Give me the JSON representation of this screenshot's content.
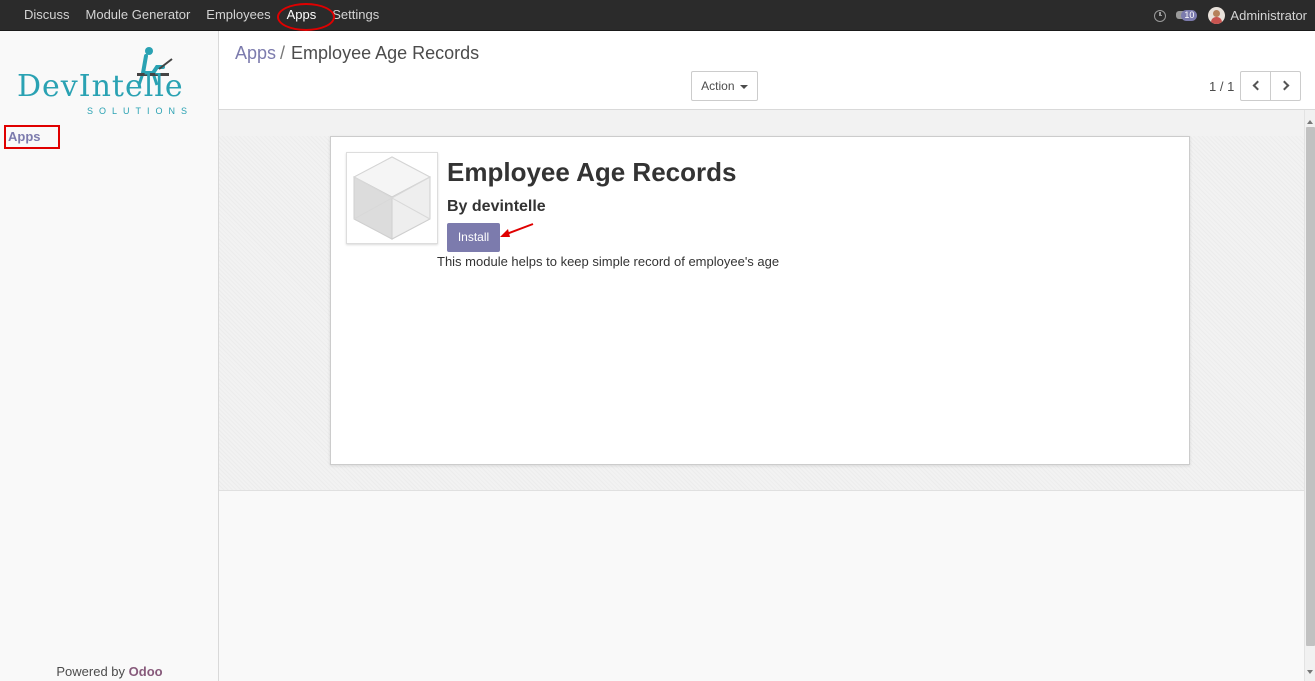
{
  "topbar": {
    "menu": [
      "Discuss",
      "Module Generator",
      "Employees",
      "Apps",
      "Settings"
    ],
    "active_menu": "Apps",
    "chat_count": "10",
    "user_name": "Administrator"
  },
  "sidebar": {
    "logo_text_main": "DevIntelle",
    "logo_text_sub": "SOLUTIONS",
    "nav_item": "Apps",
    "powered_prefix": "Powered by",
    "powered_brand": "Odoo"
  },
  "control": {
    "breadcrumb_root": "Apps",
    "breadcrumb_sep": "/",
    "breadcrumb_current": "Employee Age Records",
    "action_label": "Action",
    "pager_text": "1 / 1"
  },
  "module": {
    "name": "Employee Age Records",
    "author": "By devintelle",
    "install_label": "Install",
    "description": "This module helps to keep simple record of employee's age"
  },
  "icons": [
    "clock-icon",
    "chat-icon",
    "avatar",
    "caret-down-icon",
    "chevron-left-icon",
    "chevron-right-icon",
    "module-cube-icon",
    "red-arrow-annotation"
  ],
  "colors": {
    "topbar": "#2b2b2b",
    "accent": "#7c7bad",
    "odoo_brand": "#875a7b",
    "logo_teal": "#2aa2b3",
    "annotation_red": "#e00000"
  }
}
